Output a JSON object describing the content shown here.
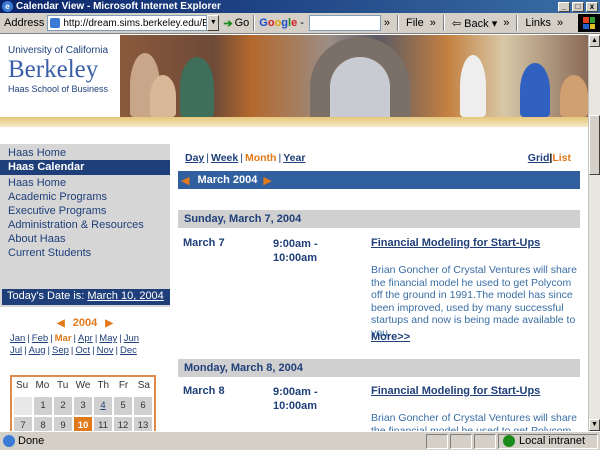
{
  "window": {
    "title": "Calendar View - Microsoft Internet Explorer",
    "min": "_",
    "max": "□",
    "close": "x"
  },
  "toolbar": {
    "address_label": "Address",
    "address_value": "http://dream.sims.berkeley.edu/EventCalendar",
    "go_label": "Go",
    "google_parts": [
      "G",
      "o",
      "o",
      "g",
      "l",
      "e"
    ],
    "google_suffix": "-",
    "file_label": "File",
    "back_label": "Back",
    "links_label": "Links",
    "expand": "»"
  },
  "header": {
    "uc": "University of California",
    "berkeley": "Berkeley",
    "haas": "Haas School of Business"
  },
  "nav": {
    "top": "Haas Home",
    "active": "Haas Calendar",
    "items": [
      "Haas Home",
      "Academic Programs",
      "Executive Programs",
      "Administration & Resources",
      "About Haas",
      "Current Students"
    ]
  },
  "today": {
    "label": "Today's Date is: ",
    "value": "March 10, 2004"
  },
  "minical": {
    "year": "2004",
    "months_row1": [
      "Jan",
      "Feb",
      "Mar",
      "Apr",
      "May",
      "Jun"
    ],
    "months_row2": [
      "Jul",
      "Aug",
      "Sep",
      "Oct",
      "Nov",
      "Dec"
    ],
    "current_month": "Mar",
    "weekdays": [
      "Su",
      "Mo",
      "Tu",
      "We",
      "Th",
      "Fr",
      "Sa"
    ],
    "cells": [
      "",
      "1",
      "2",
      "3",
      "4",
      "5",
      "6",
      "7",
      "8",
      "9",
      "10",
      "11",
      "12",
      "13"
    ],
    "linked_days": [
      "4"
    ],
    "today_day": "10"
  },
  "main": {
    "views": [
      "Day",
      "Week",
      "Month",
      "Year"
    ],
    "current_view": "Month",
    "view_types": [
      "Grid",
      "List"
    ],
    "current_type": "List",
    "month_label": "March 2004",
    "days": [
      {
        "header": "Sunday, March 7, 2004",
        "date": "March 7",
        "time": "9:00am - 10:00am",
        "title": "Financial Modeling for Start-Ups",
        "desc": "Brian Goncher of Crystal Ventures will share the financial model he used to get Polycom off the ground in 1991.The model has since been improved, used by many successful startups and now is being made available to you.",
        "more": "More>>"
      },
      {
        "header": "Monday, March 8, 2004",
        "date": "March 8",
        "time": "9:00am - 10:00am",
        "title": "Financial Modeling for Start-Ups",
        "desc": "Brian Goncher of Crystal Ventures will share the financial model he used to get Polycom off",
        "more": ""
      }
    ]
  },
  "status": {
    "text": "Done",
    "zone": "Local intranet"
  },
  "colors": {
    "navy": "#1e3f79",
    "orange": "#e07a1a",
    "band_gray": "#d6d6d6"
  }
}
